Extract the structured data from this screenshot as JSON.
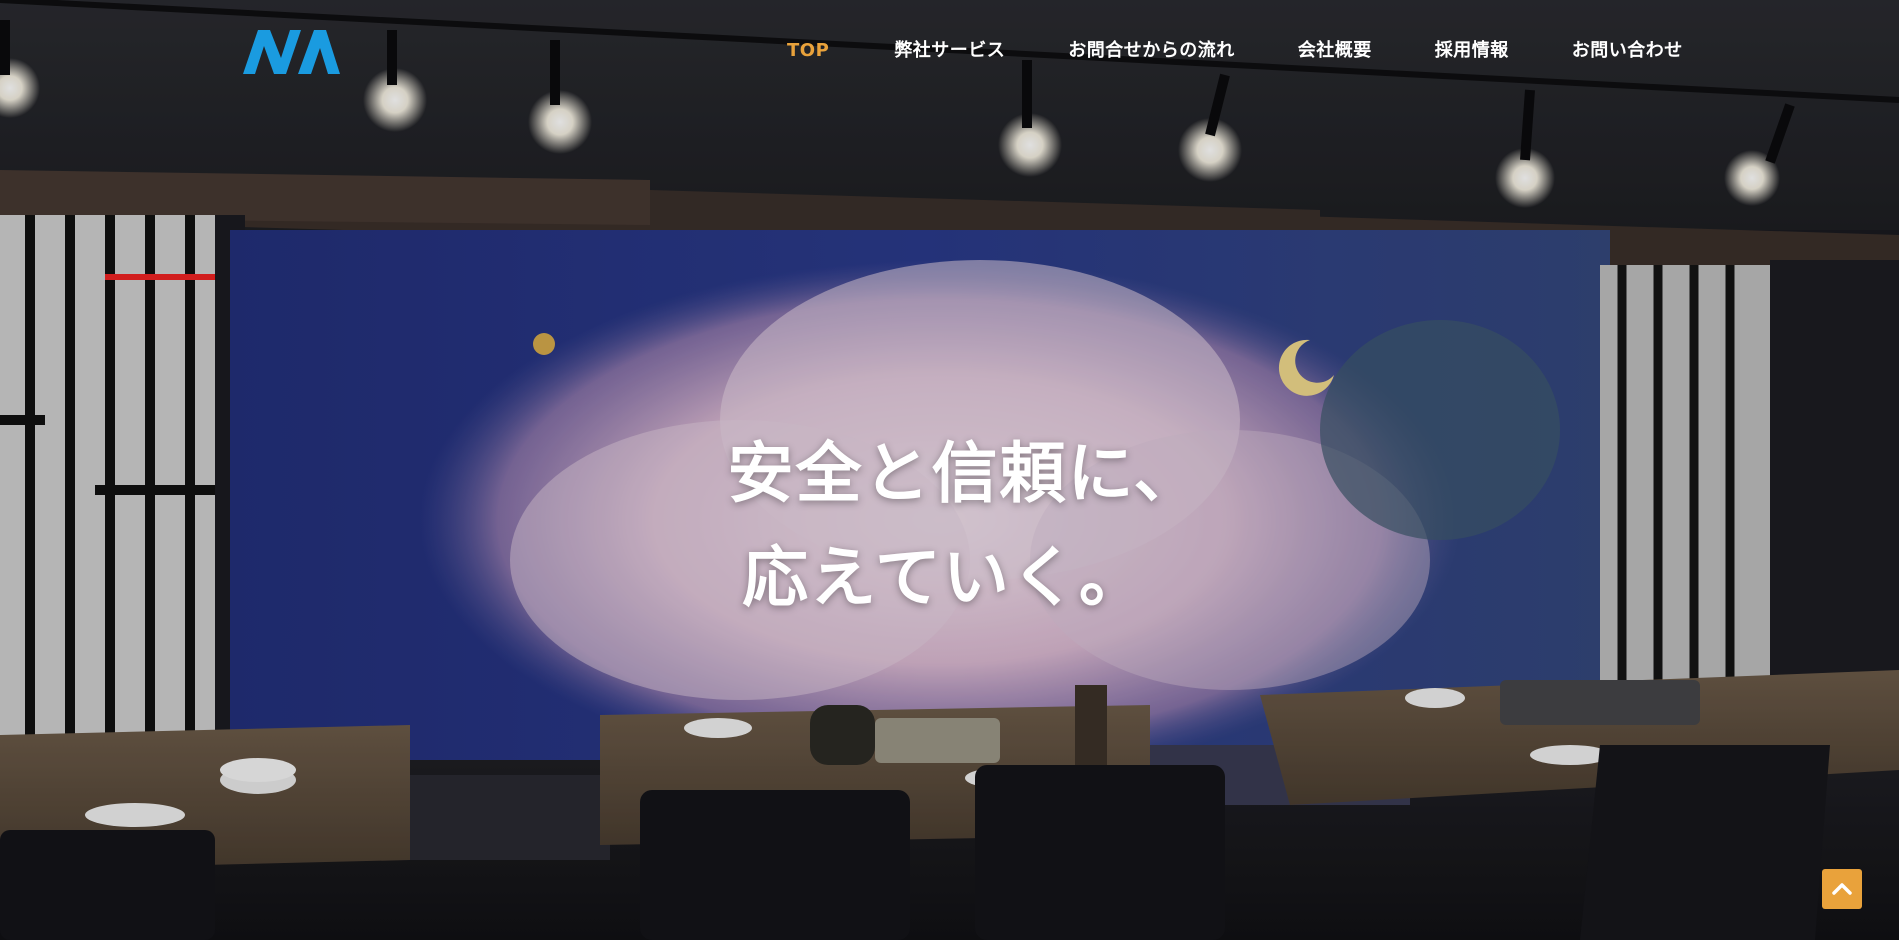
{
  "brand": {
    "logo_text": "NA",
    "logo_color": "#1a9be0"
  },
  "nav": {
    "items": [
      {
        "label": "TOP",
        "active": true
      },
      {
        "label": "弊社サービス",
        "active": false
      },
      {
        "label": "お問合せからの流れ",
        "active": false
      },
      {
        "label": "会社概要",
        "active": false
      },
      {
        "label": "採用情報",
        "active": false
      },
      {
        "label": "お問い合わせ",
        "active": false
      }
    ],
    "active_color": "#e9a23b",
    "text_color": "#ffffff"
  },
  "hero": {
    "headline_line1": "安全と信頼に、",
    "headline_line2": "応えていく。",
    "image_description_icon": "restaurant-interior-photo"
  },
  "back_to_top": {
    "icon": "chevron-up-icon",
    "color": "#e9a23b"
  }
}
